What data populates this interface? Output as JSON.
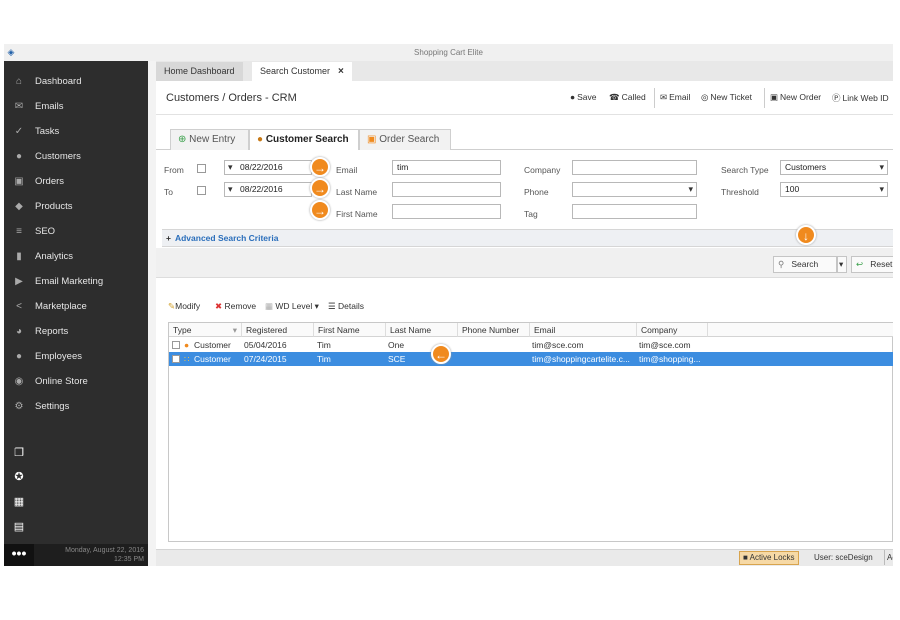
{
  "window": {
    "title": "Shopping Cart Elite"
  },
  "sidebar": {
    "items": [
      {
        "label": "Dashboard",
        "icon": "home-icon"
      },
      {
        "label": "Emails",
        "icon": "envelope-icon"
      },
      {
        "label": "Tasks",
        "icon": "tasks-icon"
      },
      {
        "label": "Customers",
        "icon": "user-icon"
      },
      {
        "label": "Orders",
        "icon": "cart-icon"
      },
      {
        "label": "Products",
        "icon": "tag-icon"
      },
      {
        "label": "SEO",
        "icon": "sliders-icon"
      },
      {
        "label": "Analytics",
        "icon": "bar-chart-icon"
      },
      {
        "label": "Email Marketing",
        "icon": "megaphone-icon"
      },
      {
        "label": "Marketplace",
        "icon": "share-icon"
      },
      {
        "label": "Reports",
        "icon": "pie-chart-icon"
      },
      {
        "label": "Employees",
        "icon": "users-icon"
      },
      {
        "label": "Online Store",
        "icon": "globe-icon"
      },
      {
        "label": "Settings",
        "icon": "gear-icon"
      }
    ],
    "footer": {
      "date": "Monday, August 22, 2016",
      "time": "12:35 PM"
    }
  },
  "tabs": [
    {
      "label": "Home Dashboard"
    },
    {
      "label": "Search Customer",
      "close": "×"
    }
  ],
  "header": {
    "breadcrumb": "Customers / Orders - CRM",
    "toolbar": {
      "save": "Save",
      "called": "Called",
      "email": "Email",
      "new_ticket": "New Ticket",
      "new_order": "New Order",
      "link_web_id": "Link Web ID"
    }
  },
  "subtabs": [
    {
      "label": "New Entry"
    },
    {
      "label": "Customer Search"
    },
    {
      "label": "Order Search"
    }
  ],
  "form": {
    "from_label": "From",
    "to_label": "To",
    "from_date": "08/22/2016",
    "to_date": "08/22/2016",
    "email_label": "Email",
    "email_value": "tim",
    "last_name_label": "Last Name",
    "last_name_value": "",
    "first_name_label": "First Name",
    "first_name_value": "",
    "company_label": "Company",
    "company_value": "",
    "phone_label": "Phone",
    "phone_value": "",
    "tag_label": "Tag",
    "tag_value": "",
    "search_type_label": "Search Type",
    "search_type_value": "Customers",
    "threshold_label": "Threshold",
    "threshold_value": "100"
  },
  "advanced": {
    "plus": "+",
    "label": "Advanced Search Criteria"
  },
  "search_buttons": {
    "search": "Search",
    "reset": "Reset"
  },
  "grid_toolbar": {
    "modify": "Modify",
    "remove": "Remove",
    "wd_level": "WD Level",
    "details": "Details"
  },
  "grid": {
    "columns": [
      "Type",
      "Registered",
      "First Name",
      "Last Name",
      "Phone Number",
      "Email",
      "Company"
    ],
    "rows": [
      {
        "type": "Customer",
        "registered": "05/04/2016",
        "first": "Tim",
        "last": "One",
        "phone": "",
        "email": "tim@sce.com",
        "company": "tim@sce.com"
      },
      {
        "type": "Customer",
        "registered": "07/24/2015",
        "first": "Tim",
        "last": "SCE",
        "phone": "",
        "email": "tim@shoppingcartelite.c...",
        "company": "tim@shopping..."
      }
    ]
  },
  "statusbar": {
    "active_locks": "Active Locks",
    "user": "User: sceDesign",
    "extra": "Ac"
  },
  "colors": {
    "sidebar_bg": "#2d2d2d",
    "accent_orange": "#f08a1e",
    "selection_blue": "#3c8de0",
    "link_blue": "#2a6ebb"
  }
}
